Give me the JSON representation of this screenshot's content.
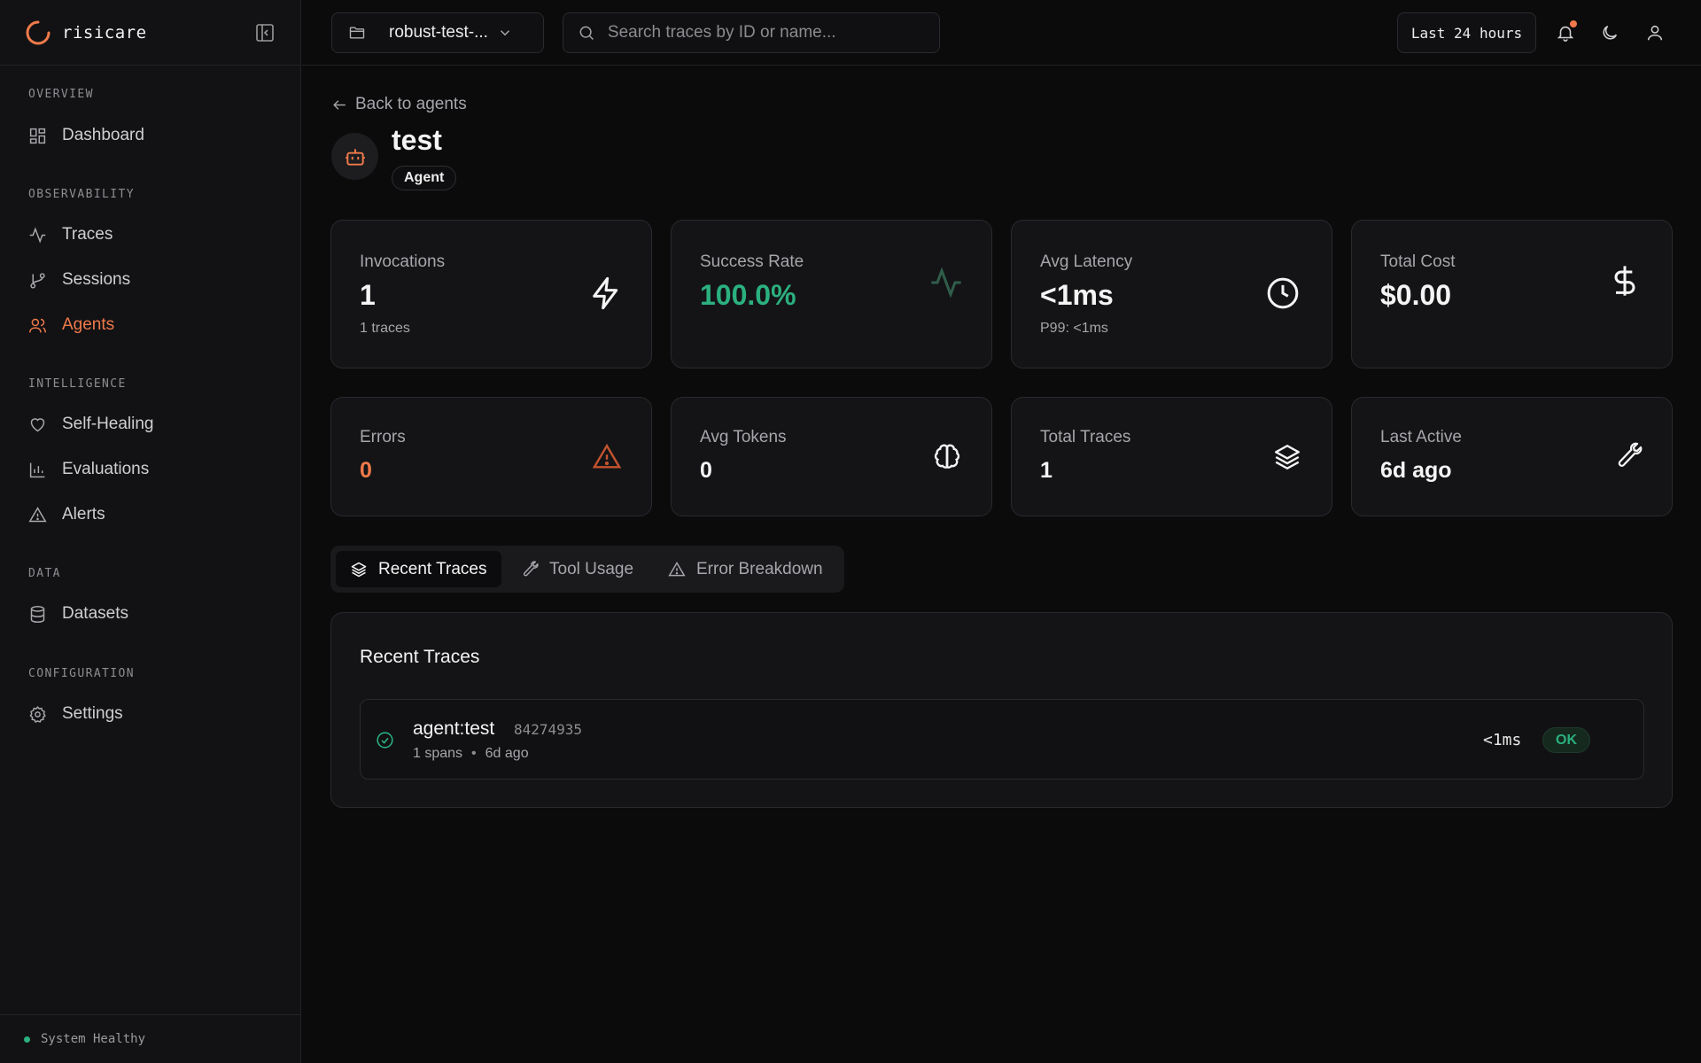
{
  "app": {
    "name": "risicare"
  },
  "sidebar": {
    "sections": [
      {
        "label": "OVERVIEW",
        "items": [
          {
            "label": "Dashboard",
            "icon": "dashboard-icon"
          }
        ]
      },
      {
        "label": "OBSERVABILITY",
        "items": [
          {
            "label": "Traces",
            "icon": "activity-icon"
          },
          {
            "label": "Sessions",
            "icon": "git-branch-icon"
          },
          {
            "label": "Agents",
            "icon": "users-icon",
            "active": true
          }
        ]
      },
      {
        "label": "INTELLIGENCE",
        "items": [
          {
            "label": "Self-Healing",
            "icon": "heart-icon"
          },
          {
            "label": "Evaluations",
            "icon": "bar-chart-icon"
          },
          {
            "label": "Alerts",
            "icon": "warning-icon"
          }
        ]
      },
      {
        "label": "DATA",
        "items": [
          {
            "label": "Datasets",
            "icon": "database-icon"
          }
        ]
      },
      {
        "label": "CONFIGURATION",
        "items": [
          {
            "label": "Settings",
            "icon": "gear-icon"
          }
        ]
      }
    ],
    "status": "System Healthy",
    "status_color": "#2bb07f"
  },
  "topbar": {
    "project": "robust-test-...",
    "search_placeholder": "Search traces by ID or name...",
    "time_range": "Last 24 hours"
  },
  "agent": {
    "back_label": "Back to agents",
    "name": "test",
    "badge": "Agent"
  },
  "stats": {
    "invocations": {
      "label": "Invocations",
      "value": "1",
      "sub": "1 traces"
    },
    "success_rate": {
      "label": "Success Rate",
      "value": "100.0%"
    },
    "avg_latency": {
      "label": "Avg Latency",
      "value": "<1ms",
      "sub": "P99: <1ms"
    },
    "total_cost": {
      "label": "Total Cost",
      "value": "$0.00"
    },
    "errors": {
      "label": "Errors",
      "value": "0"
    },
    "avg_tokens": {
      "label": "Avg Tokens",
      "value": "0"
    },
    "total_traces": {
      "label": "Total Traces",
      "value": "1"
    },
    "last_active": {
      "label": "Last Active",
      "value": "6d ago"
    }
  },
  "tabs": [
    {
      "label": "Recent Traces",
      "icon": "layers-icon",
      "active": true
    },
    {
      "label": "Tool Usage",
      "icon": "wrench-icon"
    },
    {
      "label": "Error Breakdown",
      "icon": "warning-icon"
    }
  ],
  "recent_traces": {
    "title": "Recent Traces",
    "rows": [
      {
        "name": "agent:test",
        "id": "84274935",
        "spans": "1 spans",
        "age": "6d ago",
        "duration": "<1ms",
        "status": "OK"
      }
    ]
  },
  "colors": {
    "accent": "#f07a4a",
    "success": "#2bb07f",
    "error": "#f07a4a",
    "background": "#0b0b0c"
  }
}
